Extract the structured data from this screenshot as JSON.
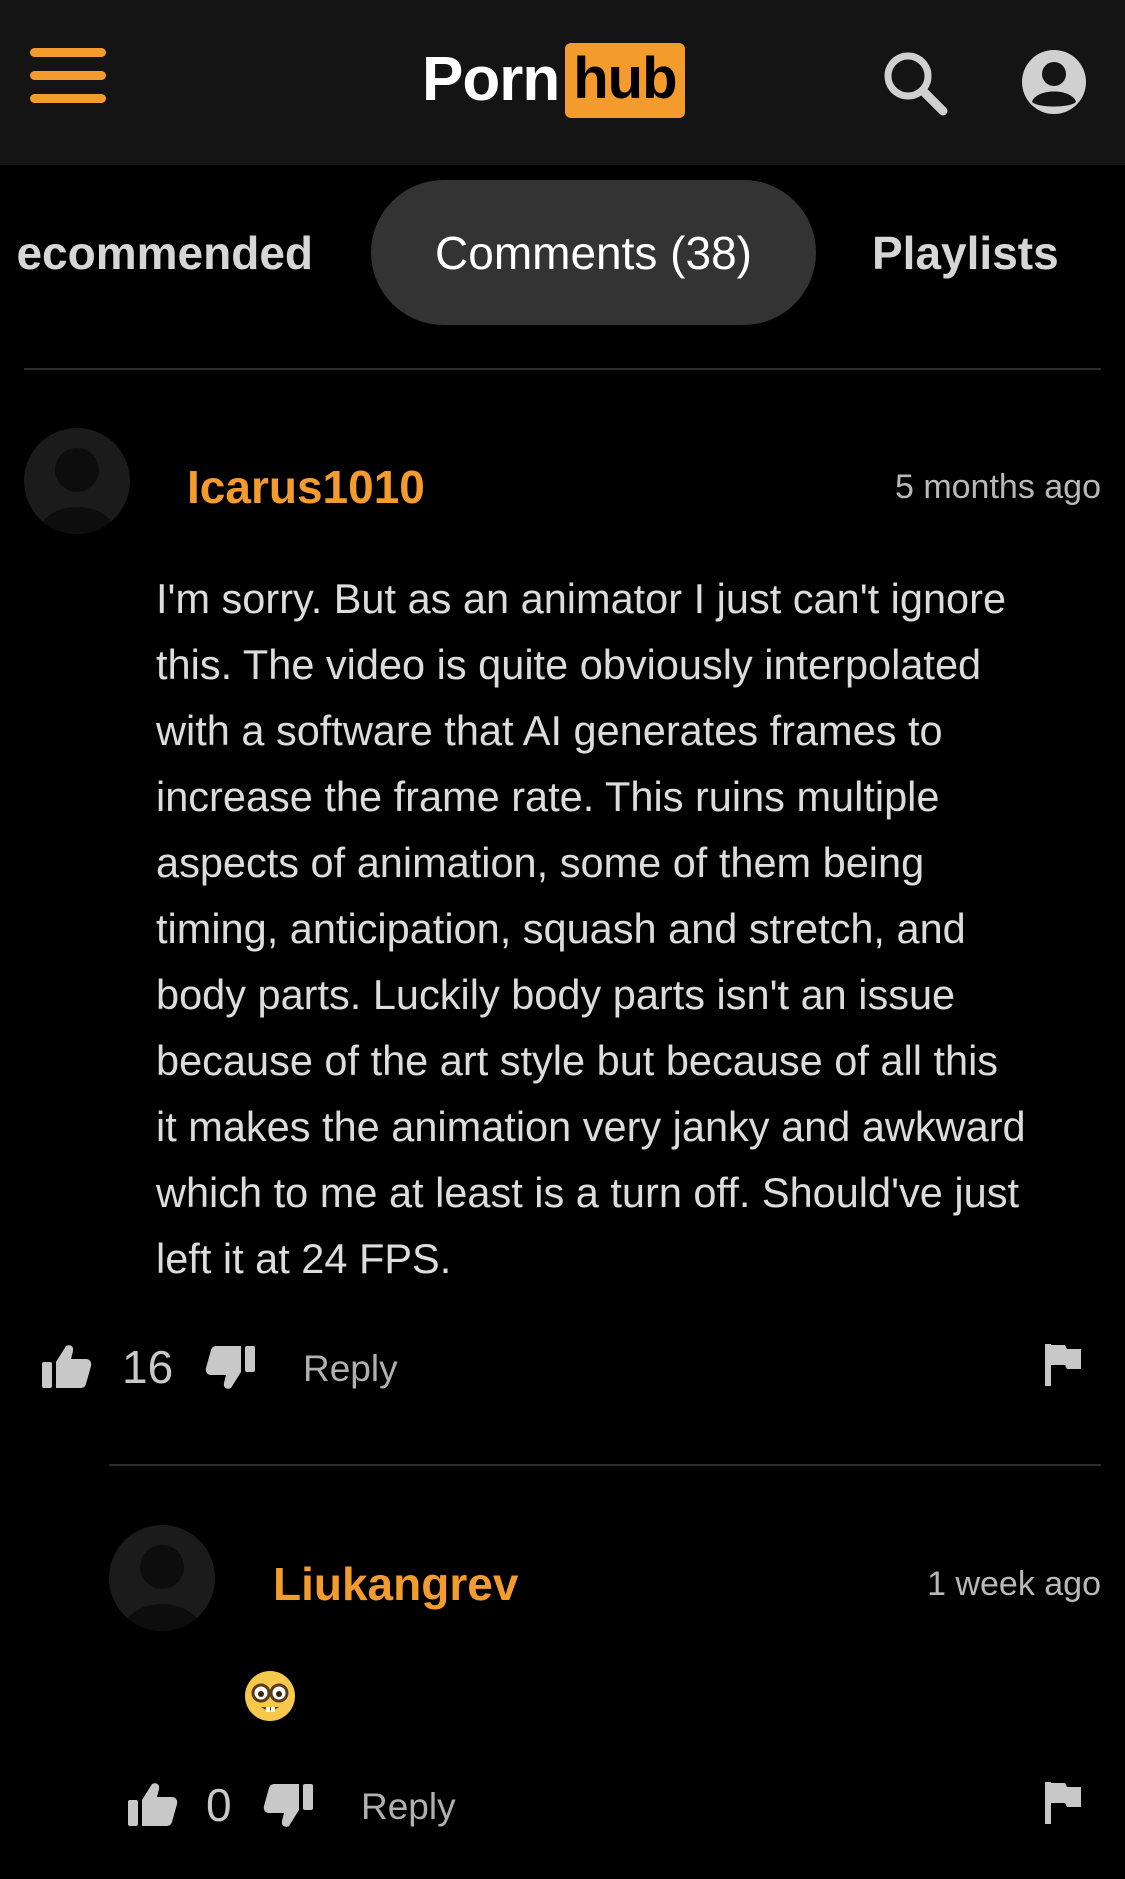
{
  "header": {
    "logo_left": "Porn",
    "logo_right": "hub",
    "menu_icon": "hamburger-menu-icon",
    "search_icon": "search-icon",
    "account_icon": "account-icon"
  },
  "tabs": [
    {
      "label": "ecommended",
      "active": false
    },
    {
      "label": "Comments (38)",
      "active": true
    },
    {
      "label": "Playlists",
      "active": false
    }
  ],
  "colors": {
    "accent": "#f39b2d",
    "background": "#000000",
    "header_background": "#141414",
    "active_tab_background": "#333333"
  },
  "comments": [
    {
      "username": "Icarus1010",
      "timestamp": "5 months ago",
      "text": "I'm sorry. But as an animator I just can't ignore\nthis. The video is quite obviously interpolated\nwith a software that AI generates frames to\nincrease the frame rate. This ruins multiple\naspects of animation, some of them being\ntiming, anticipation, squash and stretch, and\nbody parts. Luckily body parts isn't an issue\nbecause of the art style but because of all this\nit makes the animation very janky and awkward\nwhich to me at least is a turn off. Should've just\nleft it at 24 FPS.",
      "likes": "16",
      "reply_label": "Reply"
    },
    {
      "username": "Liukangrev",
      "timestamp": "1 week ago",
      "text": "🤓",
      "likes": "0",
      "reply_label": "Reply"
    }
  ]
}
